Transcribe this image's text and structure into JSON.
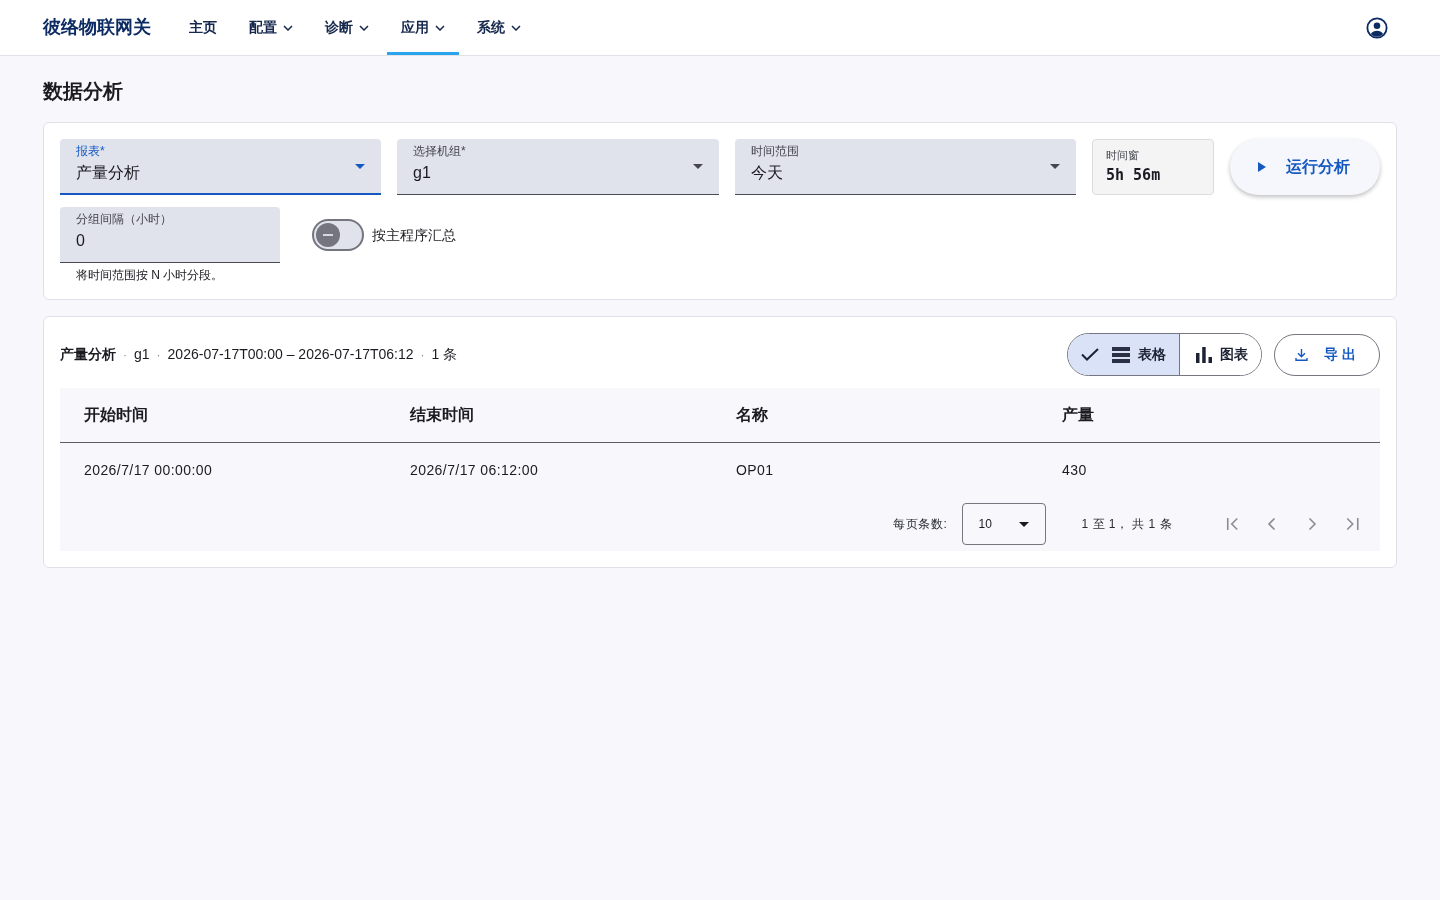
{
  "header": {
    "brand": "彼络物联网关",
    "nav": [
      {
        "label": "主页",
        "has_menu": false,
        "selected": false
      },
      {
        "label": "配置",
        "has_menu": true,
        "selected": false
      },
      {
        "label": "诊断",
        "has_menu": true,
        "selected": false
      },
      {
        "label": "应用",
        "has_menu": true,
        "selected": true
      },
      {
        "label": "系统",
        "has_menu": true,
        "selected": false
      }
    ]
  },
  "page_title": "数据分析",
  "filters": {
    "fields": [
      {
        "kind": "select",
        "label": "报表*",
        "value": "产量分析",
        "focused": true
      },
      {
        "kind": "select",
        "label": "选择机组*",
        "value": "g1",
        "focused": false
      },
      {
        "kind": "select",
        "label": "时间范围",
        "value": "今天",
        "focused": false
      },
      {
        "kind": "readout",
        "label": "时间窗",
        "value": "5h 56m"
      }
    ],
    "run_button": {
      "label": "运行分析"
    },
    "interval_field": {
      "label": "分组间隔（小时）",
      "value": "0",
      "hint": "将时间范围按 N 小时分段。"
    },
    "group_toggle": {
      "label": "按主程序汇总",
      "on": false
    }
  },
  "results": {
    "summary": [
      {
        "kind": "report",
        "text": "产量分析"
      },
      {
        "kind": "separator",
        "text": "·"
      },
      {
        "kind": "value",
        "text": "g1"
      },
      {
        "kind": "separator",
        "text": "·"
      },
      {
        "kind": "value",
        "text": "2026-07-17T00:00 – 2026-07-17T06:12"
      },
      {
        "kind": "separator",
        "text": "·"
      },
      {
        "kind": "value",
        "text": "1 条"
      }
    ],
    "view_toggle": [
      {
        "kind": "table",
        "label": "表格",
        "selected": true
      },
      {
        "kind": "chart",
        "label": "图表",
        "selected": false
      }
    ],
    "export_button": {
      "label": "导出"
    },
    "table": {
      "columns": [
        "开始时间",
        "结束时间",
        "名称",
        "产量"
      ],
      "rows": [
        [
          "2026/7/17 00:00:00",
          "2026/7/17 06:12:00",
          "OP01",
          "430"
        ]
      ]
    },
    "pagination": {
      "page_size_label": "每页条数:",
      "page_size": "10",
      "range": "1 至 1， 共 1 条",
      "buttons": [
        {
          "kind": "first",
          "disabled": true
        },
        {
          "kind": "previous",
          "disabled": true
        },
        {
          "kind": "next",
          "disabled": true
        },
        {
          "kind": "last",
          "disabled": true
        }
      ]
    }
  }
}
